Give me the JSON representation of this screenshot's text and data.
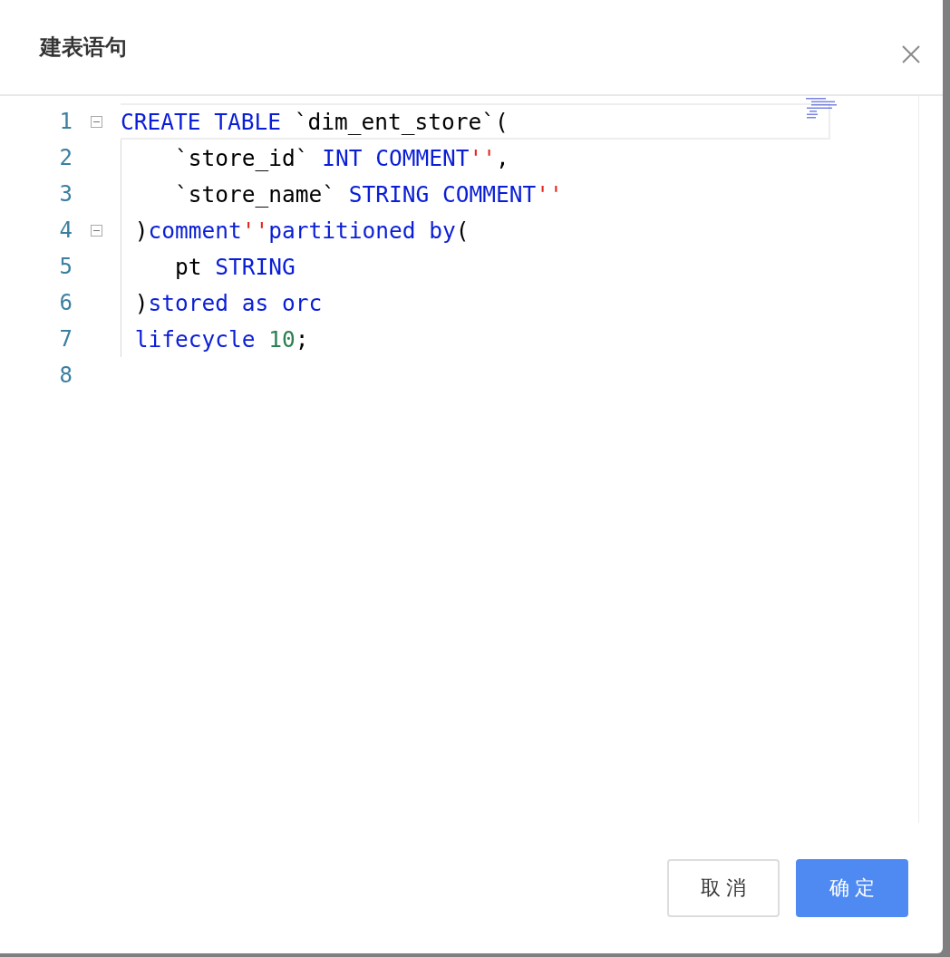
{
  "dialog": {
    "title": "建表语句"
  },
  "editor": {
    "lines": [
      {
        "number": "1",
        "fold": true,
        "active": true,
        "tokens": [
          {
            "kind": "kw",
            "text": "CREATE TABLE"
          },
          {
            "kind": "plain",
            "text": " `dim_ent_store`("
          }
        ]
      },
      {
        "number": "2",
        "fold": false,
        "active": false,
        "tokens": [
          {
            "kind": "plain",
            "text": "    `store_id` "
          },
          {
            "kind": "kw",
            "text": "INT COMMENT"
          },
          {
            "kind": "str",
            "text": "''"
          },
          {
            "kind": "plain",
            "text": ","
          }
        ]
      },
      {
        "number": "3",
        "fold": false,
        "active": false,
        "tokens": [
          {
            "kind": "plain",
            "text": "    `store_name` "
          },
          {
            "kind": "kw",
            "text": "STRING COMMENT"
          },
          {
            "kind": "str",
            "text": "''"
          }
        ]
      },
      {
        "number": "4",
        "fold": true,
        "active": false,
        "tokens": [
          {
            "kind": "plain",
            "text": " )"
          },
          {
            "kind": "kw",
            "text": "comment"
          },
          {
            "kind": "str",
            "text": "''"
          },
          {
            "kind": "kw",
            "text": "partitioned by"
          },
          {
            "kind": "plain",
            "text": "("
          }
        ]
      },
      {
        "number": "5",
        "fold": false,
        "active": false,
        "tokens": [
          {
            "kind": "plain",
            "text": "    pt "
          },
          {
            "kind": "kw",
            "text": "STRING"
          }
        ]
      },
      {
        "number": "6",
        "fold": false,
        "active": false,
        "tokens": [
          {
            "kind": "plain",
            "text": " )"
          },
          {
            "kind": "kw",
            "text": "stored as orc"
          }
        ]
      },
      {
        "number": "7",
        "fold": false,
        "active": false,
        "tokens": [
          {
            "kind": "kw",
            "text": " lifecycle "
          },
          {
            "kind": "num",
            "text": "10"
          },
          {
            "kind": "plain",
            "text": ";"
          }
        ]
      },
      {
        "number": "8",
        "fold": false,
        "active": false
      }
    ]
  },
  "buttons": [
    {
      "kind": "secondary",
      "label": "取 消"
    },
    {
      "kind": "primary",
      "label": "确 定"
    }
  ]
}
